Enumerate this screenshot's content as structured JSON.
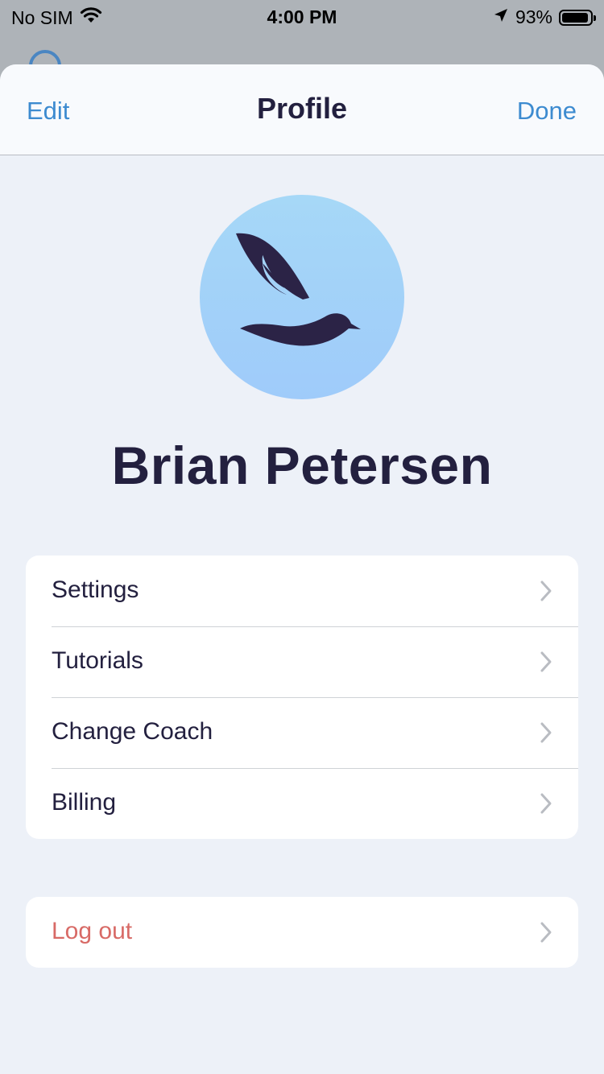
{
  "status_bar": {
    "carrier": "No SIM",
    "time": "4:00 PM",
    "battery_percent": "93%",
    "battery_level": 0.93,
    "icons": [
      "wifi-icon",
      "location-arrow-icon",
      "battery-icon"
    ]
  },
  "nav": {
    "left_label": "Edit",
    "title": "Profile",
    "right_label": "Done"
  },
  "profile": {
    "name": "Brian Petersen",
    "avatar_icon": "bird-logo-icon"
  },
  "menu": {
    "items": [
      {
        "label": "Settings"
      },
      {
        "label": "Tutorials"
      },
      {
        "label": "Change Coach"
      },
      {
        "label": "Billing"
      }
    ]
  },
  "logout": {
    "label": "Log out"
  },
  "colors": {
    "accent": "#3d8bd0",
    "text_dark": "#23203f",
    "danger": "#d86a66",
    "sheet_background": "#edf1f8",
    "avatar_background": "#a6d8f7"
  }
}
